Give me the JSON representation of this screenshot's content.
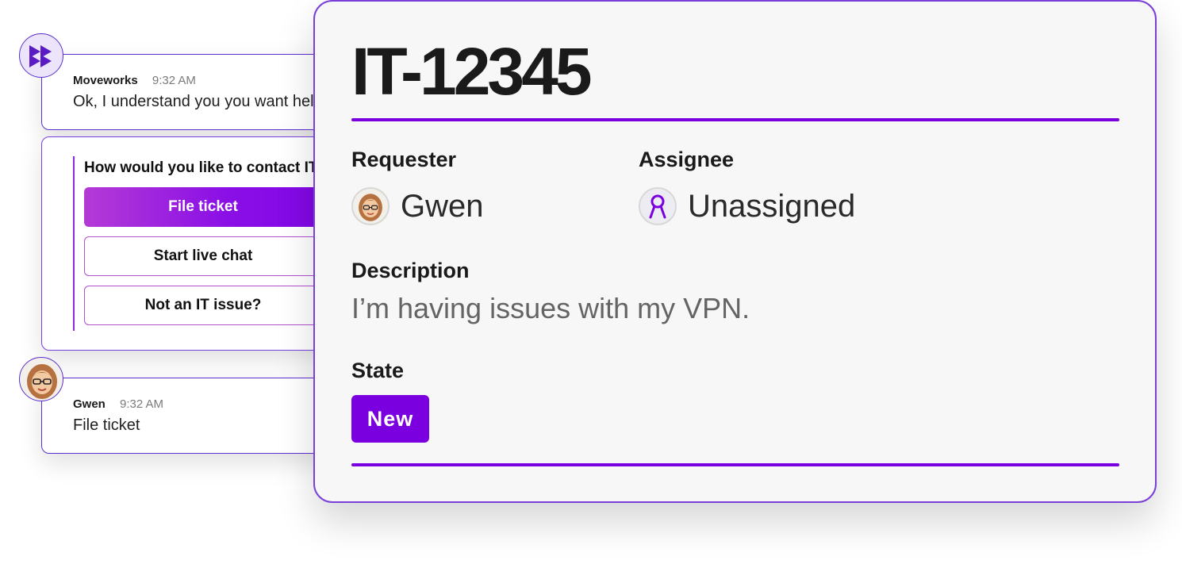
{
  "chat": {
    "bot_message": {
      "author": "Moveworks",
      "time": "9:32 AM",
      "text": "Ok, I understand you you want help"
    },
    "options": {
      "title": "How would you like to contact IT",
      "buttons": [
        "File ticket",
        "Start live chat",
        "Not an IT issue?"
      ]
    },
    "user_message": {
      "author": "Gwen",
      "time": "9:32 AM",
      "text": "File ticket"
    }
  },
  "ticket": {
    "id": "IT-12345",
    "requester_label": "Requester",
    "requester_name": "Gwen",
    "assignee_label": "Assignee",
    "assignee_name": "Unassigned",
    "description_label": "Description",
    "description_text": "I’m having issues with my VPN.",
    "state_label": "State",
    "state_value": "New"
  },
  "colors": {
    "accent": "#7a00e0",
    "border": "#5b2fd0",
    "muted_text": "#646464"
  },
  "icons": {
    "bot_avatar": "moveworks-logo-icon",
    "user_avatar": "gwen-avatar-icon",
    "assignee_avatar": "unassigned-ribbon-icon"
  }
}
